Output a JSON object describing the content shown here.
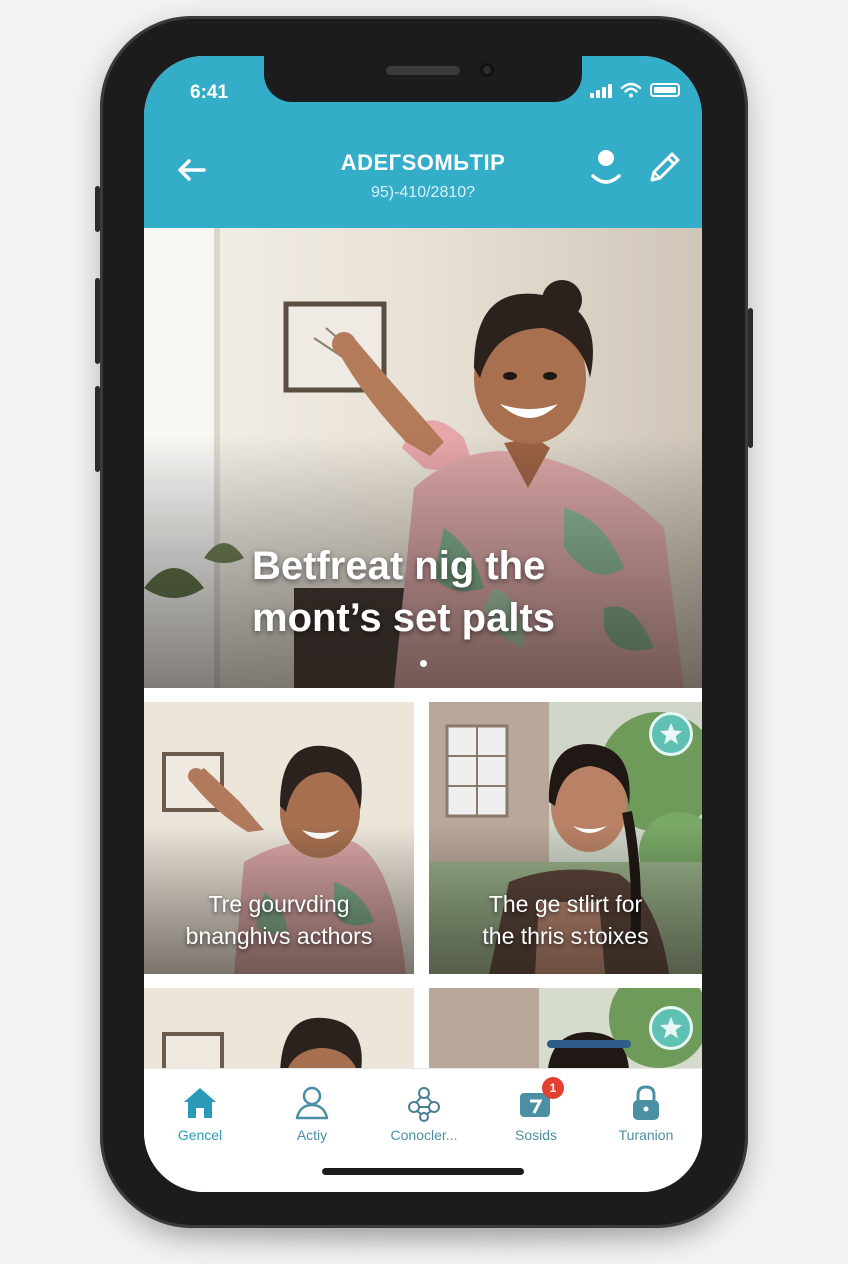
{
  "status_bar": {
    "time": "6:41"
  },
  "header": {
    "title": "ADEГSOMЬTIP",
    "subtitle": "95)-410/2810?",
    "back_icon": "arrow-left-icon",
    "profile_icon": "user-icon",
    "edit_icon": "pencil-icon"
  },
  "hero": {
    "caption_line1": "Betfreat nig the",
    "caption_line2": "mont’s set palts"
  },
  "tiles": [
    {
      "line1": "Tre gourvding",
      "line2": "bnanghivs acthors"
    },
    {
      "line1": "The ge stlirt for",
      "line2": "the thris s:toixes"
    },
    {
      "line1": "",
      "line2": ""
    },
    {
      "line1": "",
      "line2": ""
    }
  ],
  "tab_bar": {
    "items": [
      {
        "label": "Gencel",
        "icon": "home-icon",
        "active": true
      },
      {
        "label": "Actiy",
        "icon": "person-icon",
        "active": false
      },
      {
        "label": "Conocler...",
        "icon": "network-icon",
        "active": false
      },
      {
        "label": "Sosids",
        "icon": "calendar-icon",
        "active": false,
        "badge": "1"
      },
      {
        "label": "Turanion",
        "icon": "lock-icon",
        "active": false
      }
    ]
  },
  "colors": {
    "header_bg": "#34adc8",
    "accent": "#2a9ab8",
    "badge": "#e2412f"
  }
}
